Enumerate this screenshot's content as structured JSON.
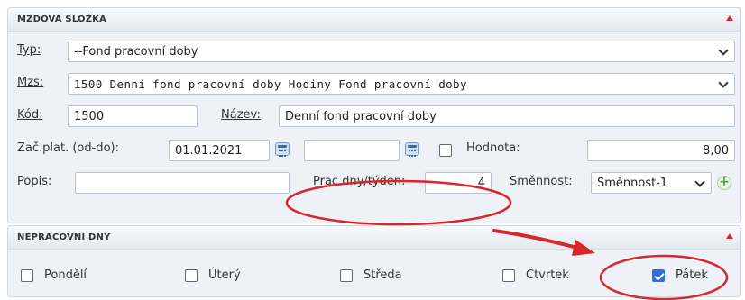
{
  "mzdova_slozka": {
    "title": "MZDOVÁ SLOŽKA",
    "typ": {
      "label": "Typ:",
      "value": "--Fond pracovní doby"
    },
    "mzs": {
      "label": "Mzs:",
      "value": "1500 Denní fond pracovní doby Hodiny Fond pracovní doby"
    },
    "kod": {
      "label": "Kód:",
      "value": "1500"
    },
    "nazev": {
      "label": "Název:",
      "value": "Denní fond pracovní doby"
    },
    "zac_plat": {
      "label": "Zač.plat. (od-do):",
      "from": "01.01.2021",
      "to": ""
    },
    "hodnota": {
      "label": "Hodnota:",
      "value": "8,00",
      "checked": false
    },
    "popis": {
      "label": "Popis:",
      "value": ""
    },
    "prac_dny": {
      "label": "Prac.dny/týden:",
      "value": "4"
    },
    "smennost": {
      "label": "Směnnost:",
      "value": "Směnnost-1"
    }
  },
  "nepracovni_dny": {
    "title": "NEPRACOVNÍ DNY",
    "days": [
      {
        "label": "Pondělí",
        "checked": false
      },
      {
        "label": "Úterý",
        "checked": false
      },
      {
        "label": "Středa",
        "checked": false
      },
      {
        "label": "Čtvrtek",
        "checked": false
      },
      {
        "label": "Pátek",
        "checked": true
      }
    ]
  },
  "colors": {
    "accent": "#2f6fdb",
    "annotation": "#d9262d",
    "panel_bg": "#eef2f6"
  }
}
